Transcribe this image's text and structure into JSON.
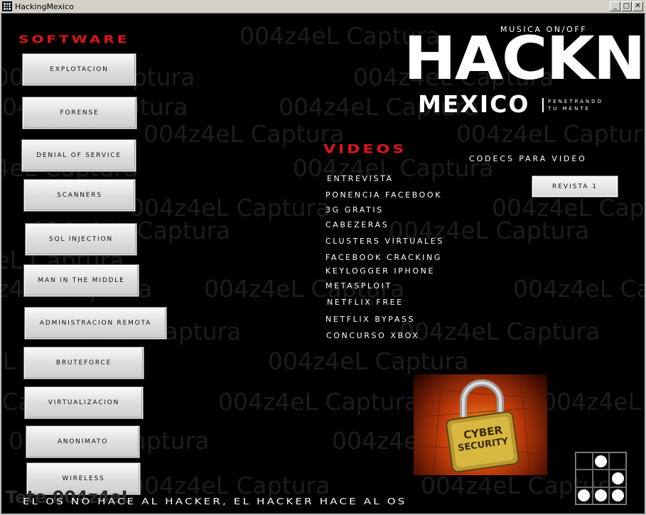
{
  "window": {
    "title": "HackingMexico",
    "minimize": "_",
    "maximize": "□",
    "close": "✕"
  },
  "watermark": {
    "text": "004z4eL Captura",
    "ghost_text": "Tete 004z4eL"
  },
  "software": {
    "heading": "SOFTWARE",
    "buttons": [
      "EXPLOTACION",
      "FORENSE",
      "DENIAL OF SERVICE",
      "SCANNERS",
      "SQL INJECTION",
      "MAN IN THE MIDDLE",
      "ADMINISTRACION REMOTA",
      "BRUTEFORCE",
      "VIRTUALIZACION",
      "ANONIMATO",
      "WIRELESS"
    ]
  },
  "logo": {
    "main": "HACKNG",
    "sub": "MEXICO",
    "tagline": "PENETRANDO TU MENTE"
  },
  "music_toggle": "MUSICA ON/OFF",
  "videos": {
    "heading": "VIDEOS",
    "links": [
      "ENTREVISTA",
      "PONENCIA FACEBOOK",
      "3G GRATIS",
      "CABEZERAS",
      "CLUSTERS VIRTUALES",
      "FACEBOOK CRACKING",
      "KEYLOGGER IPHONE",
      "METASPLOIT",
      "NETFLIX FREE",
      "NETFLIX BYPASS",
      "CONCURSO XBOX"
    ]
  },
  "codecs_link": "CODECS PARA VIDEO",
  "revista_button": "REVISTA 1",
  "cyber_image": {
    "line1": "CYBER",
    "line2": "SECURITY"
  },
  "footer": "EL OS NO HACE AL HACKER, EL HACKER HACE AL OS",
  "colors": {
    "accent_red": "#e0141c",
    "background": "#000000",
    "text": "#ffffff"
  }
}
